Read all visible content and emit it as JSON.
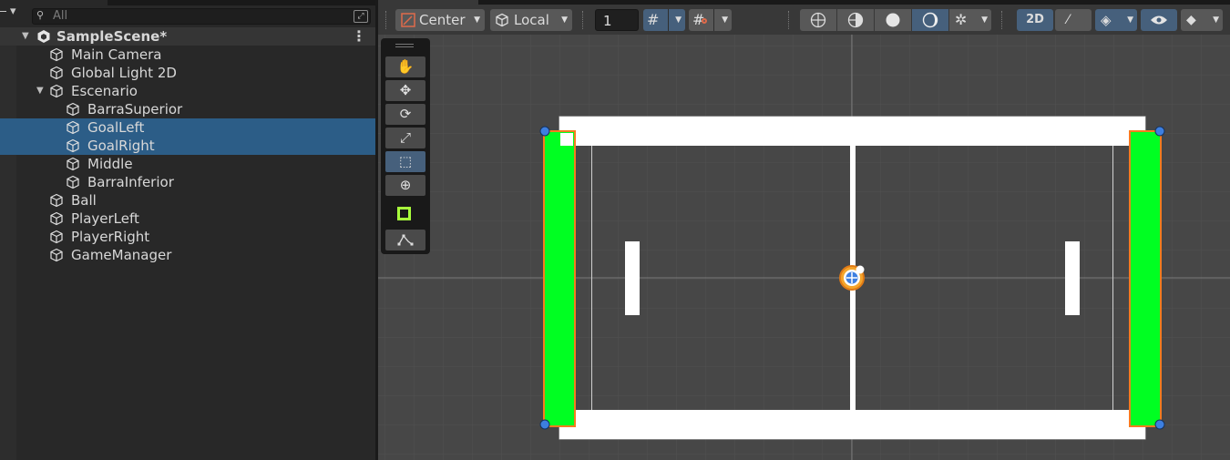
{
  "hierarchy": {
    "add_menu": "▾",
    "search": {
      "value": "All"
    },
    "scene_name": "SampleScene*",
    "scene_menu": "⋮",
    "items": [
      {
        "label": "Main Camera",
        "depth": 1,
        "expanded": null,
        "selected": false
      },
      {
        "label": "Global Light 2D",
        "depth": 1,
        "expanded": null,
        "selected": false
      },
      {
        "label": "Escenario",
        "depth": 1,
        "expanded": true,
        "selected": false
      },
      {
        "label": "BarraSuperior",
        "depth": 2,
        "expanded": null,
        "selected": false
      },
      {
        "label": "GoalLeft",
        "depth": 2,
        "expanded": null,
        "selected": true
      },
      {
        "label": "GoalRight",
        "depth": 2,
        "expanded": null,
        "selected": true
      },
      {
        "label": "Middle",
        "depth": 2,
        "expanded": null,
        "selected": false
      },
      {
        "label": "BarraInferior",
        "depth": 2,
        "expanded": null,
        "selected": false
      },
      {
        "label": "Ball",
        "depth": 1,
        "expanded": null,
        "selected": false
      },
      {
        "label": "PlayerLeft",
        "depth": 1,
        "expanded": null,
        "selected": false
      },
      {
        "label": "PlayerRight",
        "depth": 1,
        "expanded": null,
        "selected": false
      },
      {
        "label": "GameManager",
        "depth": 1,
        "expanded": null,
        "selected": false
      }
    ]
  },
  "scene_toolbar": {
    "pivot_mode": "Center",
    "pivot_rotation": "Local",
    "grid_snap_increment": "1",
    "view_2d_label": "2D"
  },
  "scene_tools": [
    {
      "name": "hand-tool",
      "icon": "✋",
      "active": false
    },
    {
      "name": "move-tool",
      "icon": "✥",
      "active": false
    },
    {
      "name": "rotate-tool",
      "icon": "⟳",
      "active": false
    },
    {
      "name": "scale-tool",
      "icon": "⤢",
      "active": false
    },
    {
      "name": "rect-tool",
      "icon": "⬚",
      "active": true
    },
    {
      "name": "transform-tool",
      "icon": "⊕",
      "active": false
    }
  ],
  "colors": {
    "goal_green": "#00ff22",
    "selection_orange": "#f57c1f",
    "handle_blue": "#3d7fe0",
    "wall_white": "#ffffff",
    "collider_green": "#a8ff3c",
    "selection_blue": "#2c5d87",
    "active_tool": "#46607c"
  }
}
